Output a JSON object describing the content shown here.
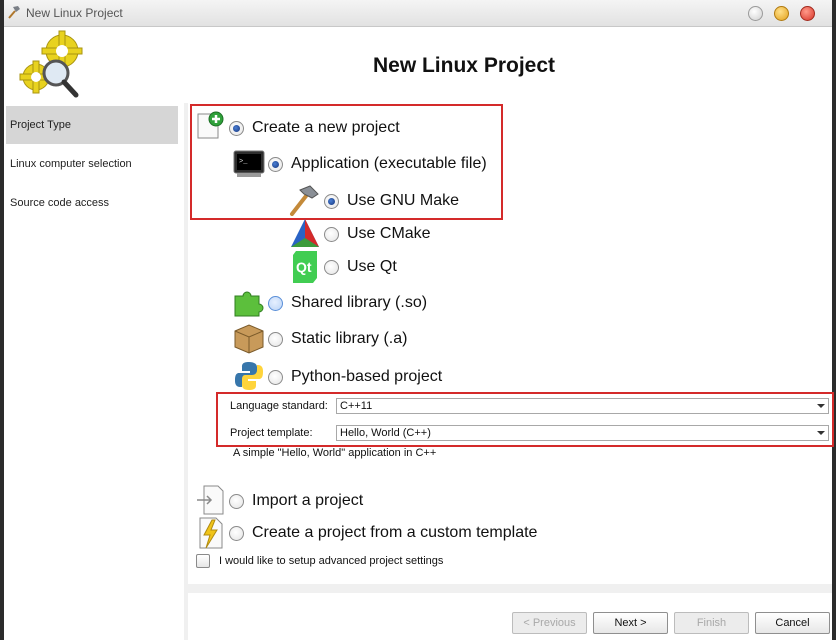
{
  "window": {
    "title": "New Linux Project"
  },
  "header": {
    "title": "New Linux Project"
  },
  "sidebar": {
    "items": [
      {
        "label": "Project Type",
        "selected": true
      },
      {
        "label": "Linux computer selection"
      },
      {
        "label": "Source code access"
      }
    ]
  },
  "options": {
    "create_new": {
      "label": "Create a new project",
      "checked": true
    },
    "application": {
      "label": "Application (executable file)",
      "checked": true
    },
    "gnu_make": {
      "label": "Use GNU Make",
      "checked": true
    },
    "cmake": {
      "label": "Use CMake"
    },
    "qt": {
      "label": "Use Qt"
    },
    "shared_lib": {
      "label": "Shared library (.so)"
    },
    "static_lib": {
      "label": "Static library (.a)"
    },
    "python": {
      "label": "Python-based project"
    },
    "import": {
      "label": "Import a project"
    },
    "custom_template": {
      "label": "Create a project from a custom template"
    }
  },
  "settings": {
    "language_label": "Language standard:",
    "language_value": "C++11",
    "template_label": "Project template:",
    "template_value": "Hello, World (C++)",
    "description": "A simple \"Hello, World\" application in C++"
  },
  "advanced": {
    "label": "I would like to setup advanced project settings",
    "checked": false
  },
  "buttons": {
    "previous": "Previous",
    "next": "Next >",
    "finish": "Finish",
    "cancel": "Cancel"
  },
  "icons": {
    "app_icon": "hammer-icon",
    "logo": "gears-magnifier-icon",
    "new_project": "new-document-plus-icon",
    "application": "terminal-icon",
    "gnu_make": "hammer-icon",
    "cmake": "cmake-triangle-icon",
    "qt": "qt-logo-icon",
    "shared": "puzzle-piece-icon",
    "static": "box-icon",
    "python": "python-logo-icon",
    "import": "import-document-icon",
    "custom_template": "lightning-document-icon"
  },
  "colors": {
    "highlight": "#d42a2a",
    "selected_side": "#d6d6d6"
  }
}
